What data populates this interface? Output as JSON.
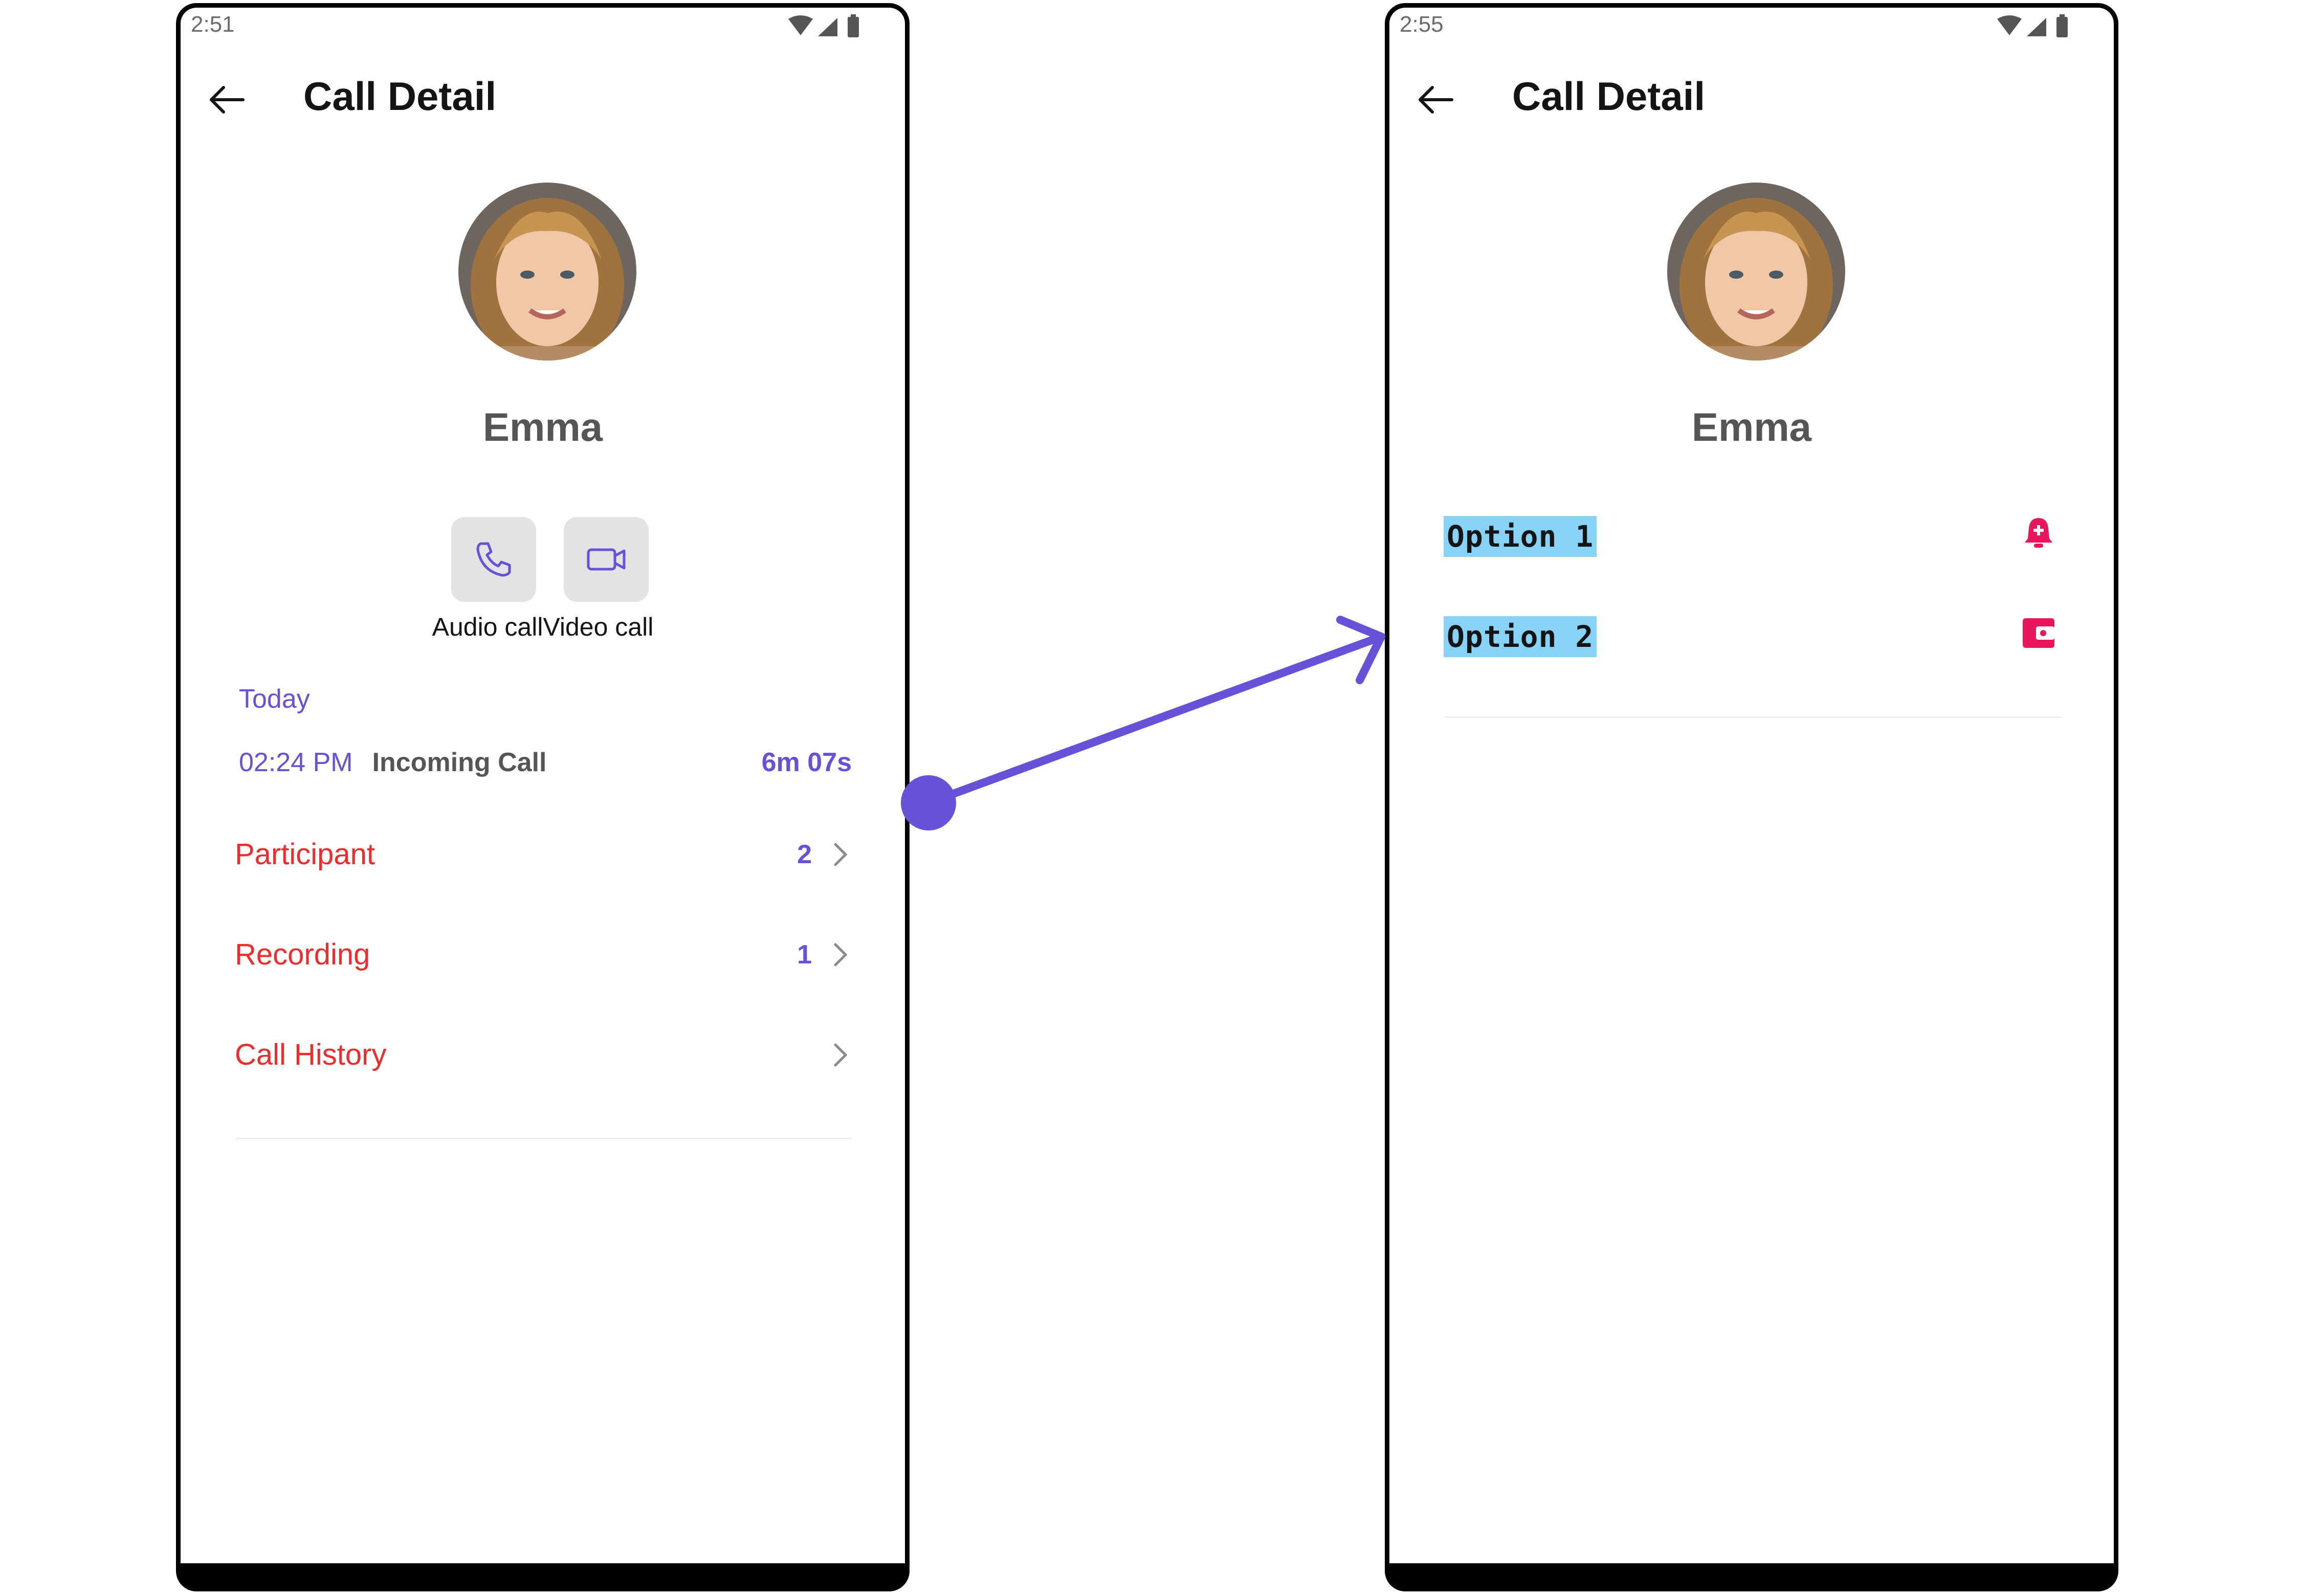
{
  "colors": {
    "accent": "#6851d6",
    "danger": "#f02b2b",
    "option_icon": "#e8175d",
    "option_highlight": "#86d3f7",
    "button_bg": "#e3e3e3"
  },
  "left_screen": {
    "status_time": "2:51",
    "title": "Call Detail",
    "contact_name": "Emma",
    "actions": [
      {
        "label": "Audio call",
        "icon": "phone-icon"
      },
      {
        "label": "Video call",
        "icon": "video-camera-icon"
      }
    ],
    "call_log": {
      "date_header": "Today",
      "time": "02:24 PM",
      "type": "Incoming Call",
      "duration": "6m 07s"
    },
    "list_items": [
      {
        "label": "Participant",
        "count": "2"
      },
      {
        "label": "Recording",
        "count": "1"
      },
      {
        "label": "Call History",
        "count": ""
      }
    ]
  },
  "right_screen": {
    "status_time": "2:55",
    "title": "Call Detail",
    "contact_name": "Emma",
    "options": [
      {
        "label": "Option 1",
        "icon": "bell-plus-icon"
      },
      {
        "label": "Option 2",
        "icon": "wallet-icon"
      }
    ]
  }
}
